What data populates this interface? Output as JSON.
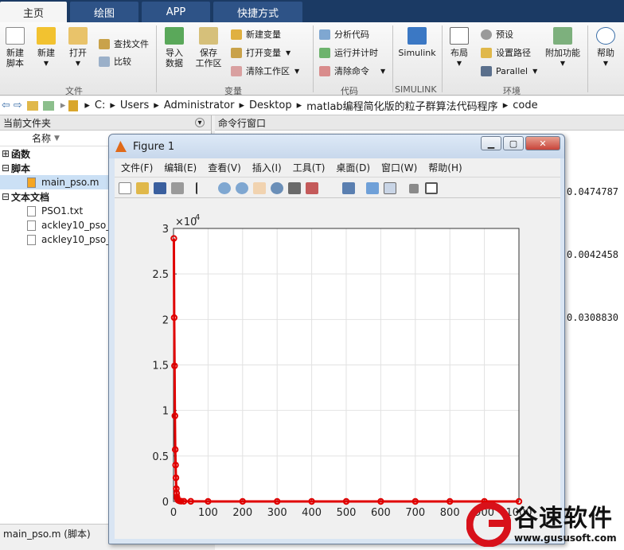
{
  "tabs": [
    "主页",
    "绘图",
    "APP",
    "快捷方式"
  ],
  "ribbon": {
    "file_group": {
      "new_script": "新建\n脚本",
      "new": "新建",
      "open": "打开",
      "find_files": "查找文件",
      "compare": "比较",
      "label": "文件"
    },
    "variable_group": {
      "import_data": "导入\n数据",
      "save_workspace": "保存\n工作区",
      "new_variable": "新建变量",
      "open_variable": "打开变量",
      "clear_workspace": "清除工作区",
      "label": "变量"
    },
    "code_group": {
      "analyze_code": "分析代码",
      "run_and_time": "运行并计时",
      "clear_commands": "清除命令",
      "label": "代码"
    },
    "simulink_group": {
      "simulink": "Simulink",
      "label": "SIMULINK"
    },
    "environment_group": {
      "layout": "布局",
      "preferences": "预设",
      "set_path": "设置路径",
      "parallel": "Parallel",
      "add_ons": "附加功能",
      "label": "环境"
    },
    "help": "帮助"
  },
  "address": {
    "segments": [
      "C:",
      "Users",
      "Administrator",
      "Desktop",
      "matlab编程简化版的粒子群算法代码程序",
      "code"
    ]
  },
  "current_folder": {
    "title": "当前文件夹",
    "name_col": "名称",
    "sections": [
      {
        "label": "函数",
        "items": []
      },
      {
        "label": "脚本",
        "items": [
          "main_pso.m"
        ]
      },
      {
        "label": "文本文档",
        "items": [
          "PSO1.txt",
          "ackley10_pso_",
          "ackley10_pso_"
        ]
      }
    ],
    "status": "main_pso.m  (脚本)"
  },
  "command_window": {
    "title": "命令行窗口",
    "values": [
      "0.0474787",
      "0.0042458",
      "0.0308830"
    ]
  },
  "figure": {
    "title": "Figure 1",
    "menu": [
      "文件(F)",
      "编辑(E)",
      "查看(V)",
      "插入(I)",
      "工具(T)",
      "桌面(D)",
      "窗口(W)",
      "帮助(H)"
    ],
    "exponent_label": "×10",
    "exponent_power": "4"
  },
  "watermark": {
    "brand": "谷速软件",
    "url": "www.gususoft.com"
  },
  "colors": {
    "line": "#e00000",
    "titlebar": "#1b3a64",
    "tab": "#2e5387"
  },
  "chart_data": {
    "type": "line",
    "title": "",
    "xlabel": "",
    "ylabel": "",
    "xlim": [
      0,
      1000
    ],
    "ylim": [
      0,
      3
    ],
    "y_multiplier_label": "×10^4",
    "xticks": [
      0,
      100,
      200,
      300,
      400,
      500,
      600,
      700,
      800,
      900,
      1000
    ],
    "yticks": [
      0,
      0.5,
      1,
      1.5,
      2,
      2.5,
      3
    ],
    "grid": true,
    "series": [
      {
        "marker": "circle",
        "color": "#e00000",
        "x": [
          1,
          2,
          3,
          4,
          5,
          6,
          7,
          8,
          9,
          10,
          11,
          13,
          15,
          18,
          22,
          30,
          50,
          100,
          200,
          300,
          400,
          500,
          600,
          700,
          800,
          900,
          1000
        ],
        "y": [
          2.89,
          2.02,
          1.49,
          0.94,
          0.57,
          0.4,
          0.26,
          0.14,
          0.09,
          0.05,
          0.03,
          0.015,
          0.01,
          0.005,
          0.003,
          0.002,
          0.001,
          0.0005,
          0.0003,
          0.0002,
          0.0001,
          0.0001,
          0.0001,
          0.0001,
          0.0001,
          0.0001,
          0.0001
        ]
      }
    ]
  }
}
